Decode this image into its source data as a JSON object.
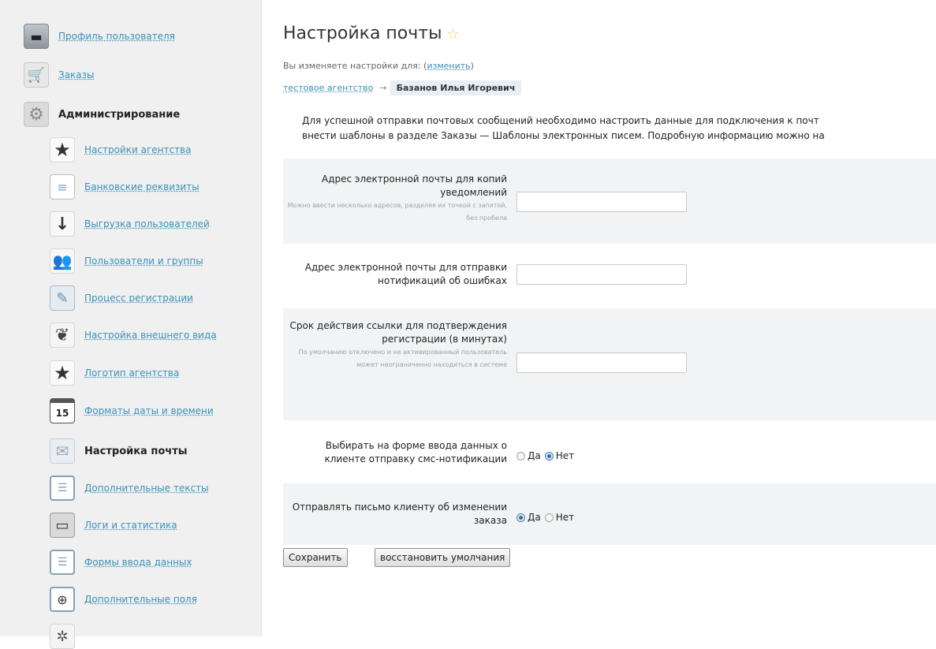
{
  "sidebar": {
    "items": [
      {
        "label": "Профиль пользователя"
      },
      {
        "label": "Заказы"
      },
      {
        "label": "Администрирование"
      },
      {
        "label": "Настройки агентства"
      },
      {
        "label": "Банковские реквизиты"
      },
      {
        "label": "Выгрузка пользователей"
      },
      {
        "label": "Пользователи и группы"
      },
      {
        "label": "Процесс регистрации"
      },
      {
        "label": "Настройка внешнего вида"
      },
      {
        "label": "Логотип агентства"
      },
      {
        "label": "Форматы даты и времени"
      },
      {
        "label": "Настройка почты"
      },
      {
        "label": "Дополнительные тексты"
      },
      {
        "label": "Логи и статистика"
      },
      {
        "label": "Формы ввода данных"
      },
      {
        "label": "Дополнительные поля"
      }
    ],
    "calendar_day": "15"
  },
  "main": {
    "title": "Настройка почты",
    "editing_prefix": "Вы изменяете настройки для:",
    "change_link": "изменить",
    "breadcrumb_agency": "тестовое агентство",
    "breadcrumb_user": "Базанов Илья Игоревич",
    "info_line1": "Для успешной отправки почтовых сообщений необходимо настроить данные для подключения к почт",
    "info_line2": "внести шаблоны в разделе Заказы — Шаблоны электронных писем. Подробную информацию можно на",
    "fields": {
      "copies": {
        "label": "Адрес электронной почты для копий уведомлений",
        "hint": "Можно ввести несколько адресов, разделяя их точкой с запятой, без пробела",
        "value": ""
      },
      "errors": {
        "label": "Адрес электронной почты для отправки нотификаций об ошибках",
        "value": ""
      },
      "link_ttl": {
        "label": "Срок действия ссылки для подтверждения регистрации (в минутах)",
        "hint": "По умолчанию отключено и не активированный пользователь может неограниченно находиться в системе",
        "value": ""
      },
      "sms": {
        "label": "Выбирать на форме ввода данных о клиенте отправку смс-нотификации",
        "yes": "Да",
        "no": "Нет",
        "selected": "Нет"
      },
      "notify": {
        "label": "Отправлять письмо клиенту об изменении заказа",
        "yes": "Да",
        "no": "Нет",
        "selected": "Да"
      }
    },
    "buttons": {
      "save": "Сохранить",
      "restore": "восстановить умолчания"
    }
  }
}
